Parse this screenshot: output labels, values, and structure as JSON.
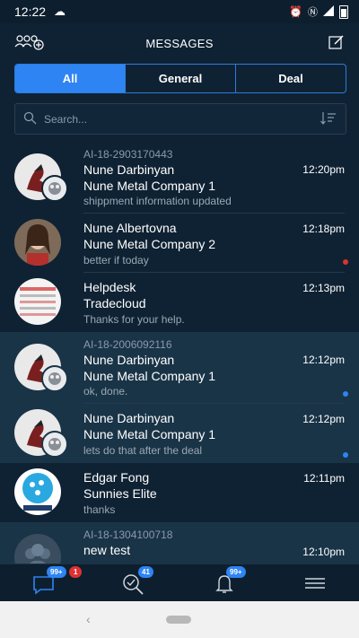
{
  "status": {
    "time": "12:22"
  },
  "header": {
    "title": "MESSAGES"
  },
  "tabs": [
    {
      "label": "All",
      "active": true
    },
    {
      "label": "General",
      "active": false
    },
    {
      "label": "Deal",
      "active": false
    }
  ],
  "search": {
    "placeholder": "Search..."
  },
  "messages": [
    {
      "tag": "AI-18-2903170443",
      "name": "Nune Darbinyan",
      "company": "Nune Metal Company 1",
      "preview": "shippment information updated",
      "time": "12:20pm",
      "dot": null,
      "highlight": false
    },
    {
      "tag": "",
      "name": "Nune Albertovna",
      "company": "Nune Metal Company 2",
      "preview": "better if today",
      "time": "12:18pm",
      "dot": "#e03131",
      "highlight": false
    },
    {
      "tag": "",
      "name": "Helpdesk",
      "company": "Tradecloud",
      "preview": "Thanks for your help.",
      "time": "12:13pm",
      "dot": null,
      "highlight": false
    },
    {
      "tag": "AI-18-2006092116",
      "name": "Nune Darbinyan",
      "company": "Nune Metal Company 1",
      "preview": "ok, done.",
      "time": "12:12pm",
      "dot": "#2e84f2",
      "highlight": true
    },
    {
      "tag": "",
      "name": "Nune Darbinyan",
      "company": "Nune Metal Company 1",
      "preview": "lets do that after the deal",
      "time": "12:12pm",
      "dot": "#2e84f2",
      "highlight": true
    },
    {
      "tag": "",
      "name": "Edgar Fong",
      "company": "Sunnies Elite",
      "preview": "thanks",
      "time": "12:11pm",
      "dot": null,
      "highlight": false
    },
    {
      "tag": "AI-18-1304100718",
      "name": "new test",
      "company": "",
      "preview": "",
      "time": "12:10pm",
      "dot": null,
      "highlight": true
    }
  ],
  "bottom_nav": {
    "chat_badge": "99+",
    "chat_alert": "1",
    "search_badge": "41",
    "notif_badge": "99+"
  },
  "colors": {
    "accent": "#2e84f2",
    "background": "#0f2233",
    "alert": "#e03131"
  }
}
